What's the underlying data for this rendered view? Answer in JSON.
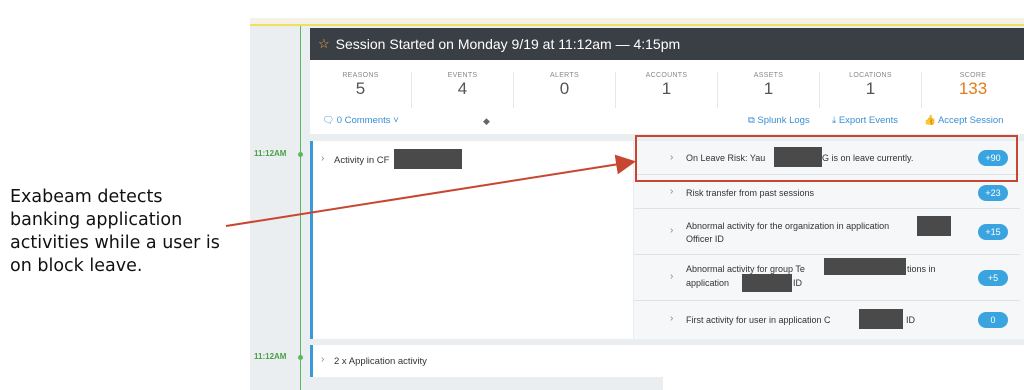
{
  "annotation": "Exabeam detects banking application activities while a user is on block leave.",
  "session": {
    "title": "Session Started on Monday 9/19 at 11:12am — 4:15pm",
    "star_icon": "star-icon"
  },
  "stats": [
    {
      "label": "REASONS",
      "value": "5"
    },
    {
      "label": "EVENTS",
      "value": "4"
    },
    {
      "label": "ALERTS",
      "value": "0"
    },
    {
      "label": "ACCOUNTS",
      "value": "1"
    },
    {
      "label": "ASSETS",
      "value": "1"
    },
    {
      "label": "LOCATIONS",
      "value": "1"
    },
    {
      "label": "SCORE",
      "value": "133"
    }
  ],
  "links": {
    "comments": "🗨 0 Comments ˅",
    "splunk": "⧉ Splunk Logs",
    "export": "⤓ Export Events",
    "accept": "👍 Accept Session"
  },
  "timeline": [
    "11:12AM",
    "11:12AM"
  ],
  "events": [
    {
      "label": "Activity in CF"
    },
    {
      "label": "2 x Application activity"
    }
  ],
  "risks": [
    {
      "line1": "On Leave Risk: Yau",
      "line1b": "G is on leave currently.",
      "line2": "",
      "score": "+90"
    },
    {
      "line1": "Risk transfer from past sessions",
      "line2": "",
      "score": "+23"
    },
    {
      "line1": "Abnormal activity for the organization in application",
      "line2": "Officer ID",
      "score": "+15"
    },
    {
      "line1": "Abnormal activity for group Te",
      "line1b": "tions in",
      "line2": "application",
      "line2b": "ID",
      "score": "+5"
    },
    {
      "line1": "First activity for user in application C",
      "line1b": "ID",
      "line2": "",
      "score": "0"
    }
  ],
  "colors": {
    "accent": "#3aa4e0",
    "header": "#3a3f45",
    "score": "#e07b1a",
    "highlight": "#c8462f",
    "timeline": "#5cb85c"
  }
}
